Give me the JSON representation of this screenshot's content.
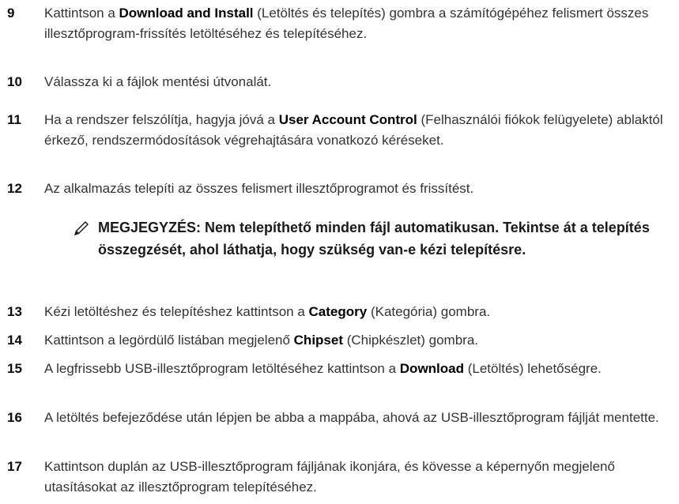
{
  "steps": [
    {
      "num": "9",
      "pre": "Kattintson a ",
      "bold": "Download and Install",
      "post": " (Letöltés és telepítés) gombra a számítógépéhez felismert összes illesztőprogram-frissítés letöltéséhez és telepítéséhez."
    },
    {
      "num": "10",
      "pre": "Válassza ki a fájlok mentési útvonalát.",
      "bold": "",
      "post": ""
    },
    {
      "num": "11",
      "pre": "Ha a rendszer felszólítja, hagyja jóvá a ",
      "bold": "User Account Control",
      "post": " (Felhasználói fiókok felügyelete) ablaktól érkező, rendszermódosítások végrehajtására vonatkozó kéréseket."
    },
    {
      "num": "12",
      "pre": "Az alkalmazás telepíti az összes felismert illesztőprogramot és frissítést.",
      "bold": "",
      "post": ""
    },
    {
      "num": "13",
      "pre": "Kézi letöltéshez és telepítéshez kattintson a ",
      "bold": "Category",
      "post": " (Kategória) gombra."
    },
    {
      "num": "14",
      "pre": "Kattintson a legördülő listában megjelenő ",
      "bold": "Chipset",
      "post": " (Chipkészlet) gombra."
    },
    {
      "num": "15",
      "pre": "A legfrissebb USB-illesztőprogram letöltéséhez kattintson a ",
      "bold": "Download",
      "post": " (Letöltés) lehetőségre."
    },
    {
      "num": "16",
      "pre": "A letöltés befejeződése után lépjen be abba a mappába, ahová az USB-illesztőprogram fájlját mentette.",
      "bold": "",
      "post": ""
    },
    {
      "num": "17",
      "pre": "Kattintson duplán az USB-illesztőprogram fájljának ikonjára, és kövesse a képernyőn megjelenő utasításokat az illesztőprogram telepítéséhez.",
      "bold": "",
      "post": ""
    }
  ],
  "note": {
    "icon": "pencil-note-icon",
    "text": "MEGJEGYZÉS: Nem telepíthető minden fájl automatikusan. Tekintse át a telepítés összegzését, ahol láthatja, hogy szükség van-e kézi telepítésre."
  }
}
